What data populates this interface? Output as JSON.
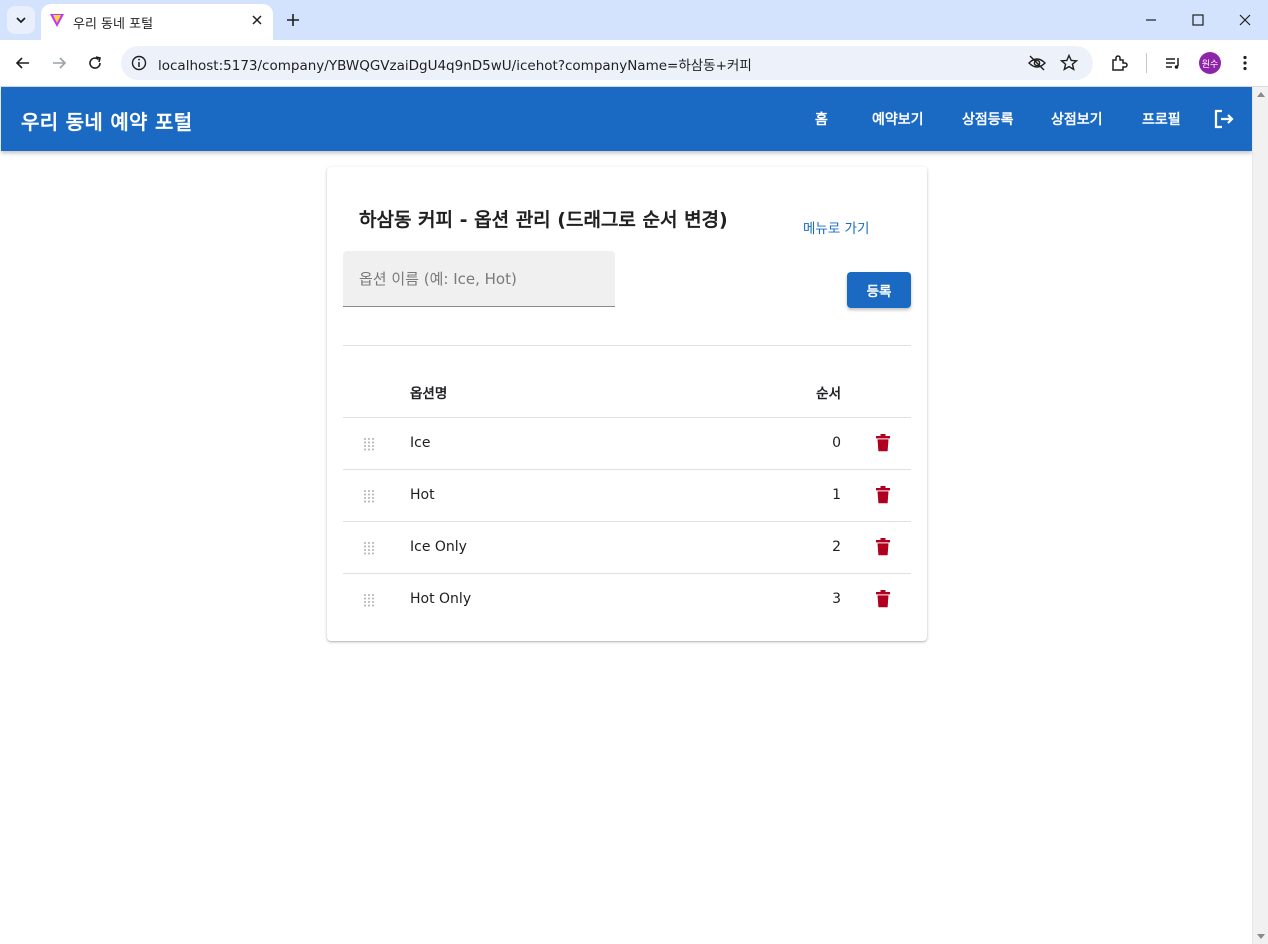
{
  "browser": {
    "tab_title": "우리 동네 포털",
    "url": "localhost:5173/company/YBWQGVzaiDgU4q9nD5wU/icehot?companyName=하삼동+커피",
    "profile_initials": "원수"
  },
  "appbar": {
    "brand": "우리 동네 예약 포털",
    "nav": [
      "홈",
      "예약보기",
      "상점등록",
      "상점보기",
      "프로필"
    ],
    "color": "#1a6ac4"
  },
  "page": {
    "title": "하삼동 커피 - 옵션 관리 (드래그로 순서 변경)",
    "menu_link": "메뉴로 가기",
    "input_placeholder": "옵션 이름 (예: Ice, Hot)",
    "input_value": "",
    "register_button": "등록"
  },
  "table": {
    "columns": {
      "name": "옵션명",
      "order": "순서"
    },
    "rows": [
      {
        "name": "Ice",
        "order": "0"
      },
      {
        "name": "Hot",
        "order": "1"
      },
      {
        "name": "Ice Only",
        "order": "2"
      },
      {
        "name": "Hot Only",
        "order": "3"
      }
    ],
    "delete_color": "#b00020"
  }
}
